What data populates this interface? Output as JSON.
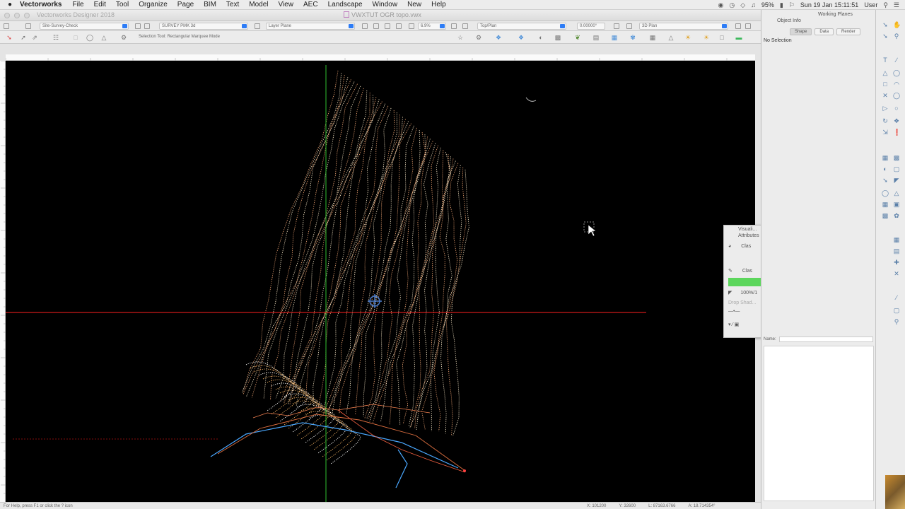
{
  "menubar": {
    "app_name": "Vectorworks",
    "menus": [
      "File",
      "Edit",
      "Tool",
      "Organize",
      "Page",
      "BIM",
      "Text",
      "Model",
      "View",
      "AEC",
      "Landscape",
      "Window",
      "New",
      "Help"
    ],
    "battery": "95%",
    "clock": "Sun 19 Jan  15:11:51",
    "user": "User"
  },
  "window": {
    "app_title": "Vectorworks Designer 2018",
    "document_title": "VWXTUT OGR topo.vwx"
  },
  "view_bar": {
    "active_class": "Site-Survey-Check",
    "active_layer": "SURVEY PMK 3d",
    "layer_plane": "Layer Plane",
    "zoom": "6.9%",
    "view": "Top/Plan",
    "rotation": "0.00000°",
    "render_mode": "3D Plan"
  },
  "tool_bar": {
    "mode_text": "Selection Tool: Rectangular Marquee Mode"
  },
  "object_info": {
    "title": "Object Info",
    "tabs": [
      "Shape",
      "Data",
      "Render"
    ],
    "active_tab": "Shape",
    "selection": "No Selection",
    "name_label": "Name:"
  },
  "working_planes": {
    "title": "Working Planes"
  },
  "attributes_palette": {
    "title_1": "Visuali...",
    "title_2": "Attributes",
    "fill_class": "Clas",
    "pen_class": "Clas",
    "opacity": "100%/1",
    "drop_shadow": "Drop Shad...",
    "fill_color": "#5cd65c"
  },
  "status_bar": {
    "help": "For Help, press F1 or click the ? icon",
    "x": "X: 101200",
    "y": "Y: 32600",
    "length": "L: 87163.6766",
    "angle": "A: 18.714354°"
  },
  "colors": {
    "canvas": "#000000",
    "contour_warm": "#e8a070",
    "contour_light": "#f0e0c0",
    "x_axis": "#ff2020",
    "y_axis": "#30c030",
    "blue_lines": "#4aa8ff"
  }
}
